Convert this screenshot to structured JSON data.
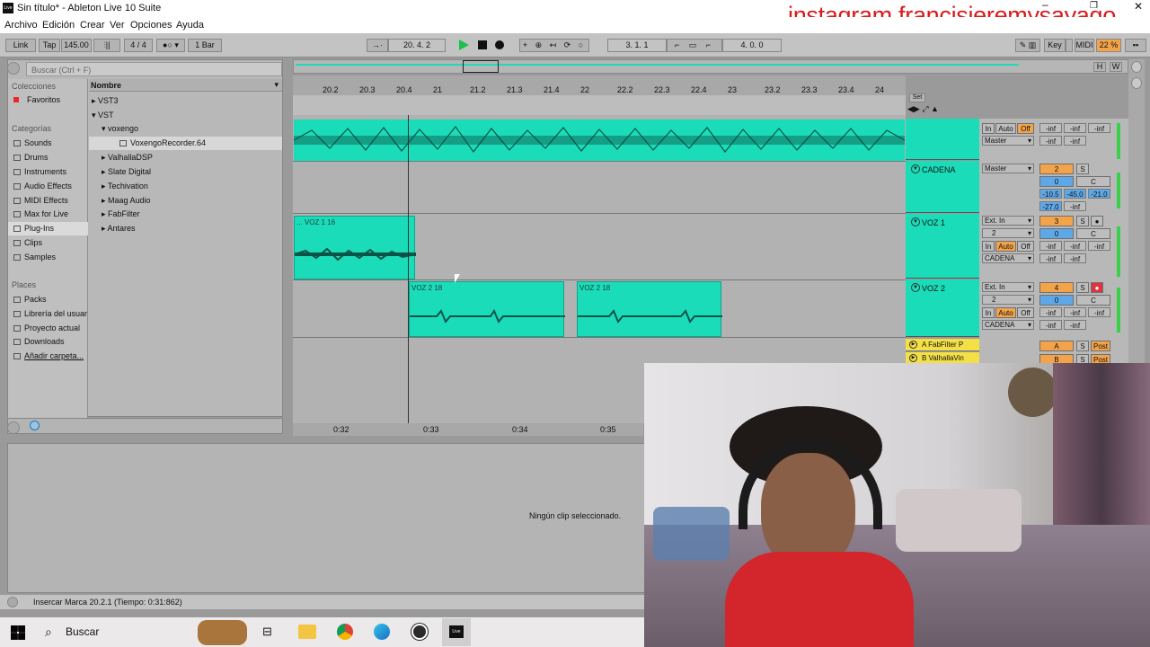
{
  "window": {
    "title": "Sin título* - Ableton Live 10 Suite",
    "watermark": "instagram francisjeremysayago"
  },
  "menu": [
    "Archivo",
    "Edición",
    "Crear",
    "Ver",
    "Opciones",
    "Ayuda"
  ],
  "transport": {
    "link": "Link",
    "tap": "Tap",
    "tempo": "145.00",
    "signature": "4 / 4",
    "quantize": "1 Bar",
    "arrangement_position": "20.  4.  2",
    "loop_start": "3.  1.  1",
    "loop_length": "4.  0.  0",
    "key": "Key",
    "midi": "MIDI",
    "cpu": "22 %",
    "H": "H",
    "W": "W"
  },
  "browser": {
    "search_placeholder": "Buscar (Ctrl + F)",
    "collections_title": "Colecciones",
    "favorites": "Favoritos",
    "categories_title": "Categorías",
    "categories": [
      "Sounds",
      "Drums",
      "Instruments",
      "Audio Effects",
      "MIDI Effects",
      "Max for Live",
      "Plug-Ins",
      "Clips",
      "Samples"
    ],
    "places_title": "Places",
    "places": [
      "Packs",
      "Librería del usuario",
      "Proyecto actual",
      "Downloads",
      "Añadir carpeta..."
    ],
    "column_header": "Nombre",
    "tree": [
      "VST3",
      "VST",
      "voxengo",
      "VoxengoRecorder.64",
      "ValhallaDSP",
      "Slate Digital",
      "Techivation",
      "Maag Audio",
      "FabFilter",
      "Antares"
    ]
  },
  "ruler": {
    "bars": [
      "20.2",
      "20.3",
      "20.4",
      "21",
      "21.2",
      "21.3",
      "21.4",
      "22",
      "22.2",
      "22.3",
      "22.4",
      "23",
      "23.2",
      "23.3",
      "23.4",
      "24"
    ],
    "times": [
      "0:32",
      "0:33",
      "0:34",
      "0:35"
    ],
    "set": "Set"
  },
  "tracks": [
    {
      "name": "",
      "routing": "Master",
      "in": "In",
      "auto": "Auto",
      "off": "Off",
      "vol": [
        "-inf",
        "-inf",
        "-inf"
      ],
      "vol2": [
        "-inf",
        "-inf"
      ]
    },
    {
      "name": "CADENA",
      "routing": "Master",
      "num": "2",
      "solo": "S",
      "vol": "0",
      "pan": "C",
      "levels": [
        "-10.5",
        "-45.0",
        "-21.0",
        "-27.0",
        "-inf"
      ]
    },
    {
      "name": "VOZ 1",
      "input": "Ext. In",
      "channel": "2",
      "routing": "CADENA",
      "in": "In",
      "auto": "Auto",
      "off": "Off",
      "num": "3",
      "solo": "S",
      "vol": "0",
      "pan": "C",
      "meters": [
        "-inf",
        "-inf",
        "-inf",
        "-inf",
        "-inf"
      ]
    },
    {
      "name": "VOZ 2",
      "input": "Ext. In",
      "channel": "2",
      "routing": "CADENA",
      "in": "In",
      "auto": "Auto",
      "off": "Off",
      "num": "4",
      "solo": "S",
      "vol": "0",
      "pan": "C",
      "meters": [
        "-inf",
        "-inf",
        "-inf",
        "-inf",
        "-inf"
      ]
    },
    {
      "name": "A FabFilter P",
      "num": "A",
      "solo": "S",
      "post": "Post"
    },
    {
      "name": "B ValhallaVin",
      "num": "B",
      "solo": "S",
      "post": "Post"
    }
  ],
  "clips": [
    {
      "name": "... VOZ 1 16"
    },
    {
      "name": "VOZ 2 18"
    },
    {
      "name": "VOZ 2 18"
    }
  ],
  "detail": {
    "empty": "Ningún clip seleccionado."
  },
  "status": {
    "text": "Insercar Marca 20.2.1 (Tiempo: 0:31:862)"
  },
  "taskbar": {
    "search": "Buscar"
  },
  "colors": {
    "clip": "#1bdcb9",
    "track_yellow": "#f3a34a",
    "play": "#19c24b",
    "record": "#e0333d"
  }
}
